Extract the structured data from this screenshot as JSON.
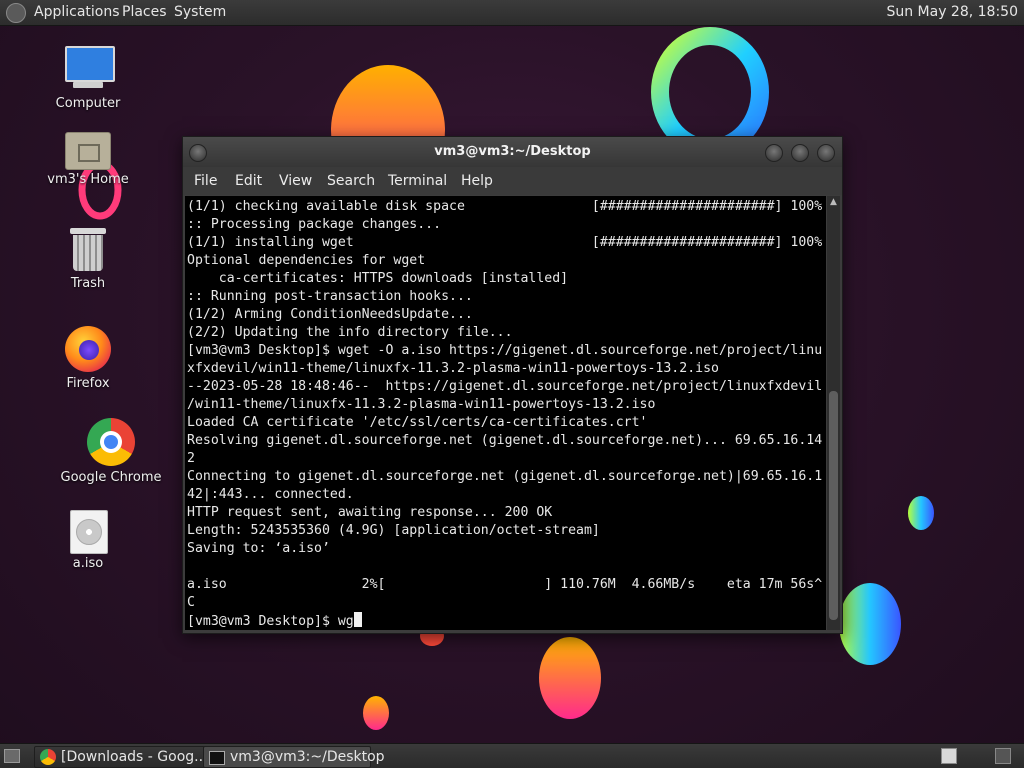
{
  "top_panel": {
    "menus": [
      "Applications",
      "Places",
      "System"
    ],
    "clock": "Sun May 28, 18:50"
  },
  "desktop_icons": [
    {
      "label": "Computer",
      "icon": "computer-icon"
    },
    {
      "label": "vm3's Home",
      "icon": "home-folder-icon"
    },
    {
      "label": "Trash",
      "icon": "trash-icon"
    },
    {
      "label": "Firefox",
      "icon": "firefox-icon"
    },
    {
      "label": "Google Chrome",
      "icon": "chrome-icon"
    },
    {
      "label": "a.iso",
      "icon": "disc-image-icon"
    }
  ],
  "terminal": {
    "title": "vm3@vm3:~/Desktop",
    "menu": [
      "File",
      "Edit",
      "View",
      "Search",
      "Terminal",
      "Help"
    ],
    "output": "(1/1) checking available disk space                [######################] 100%\n:: Processing package changes...\n(1/1) installing wget                              [######################] 100%\nOptional dependencies for wget\n    ca-certificates: HTTPS downloads [installed]\n:: Running post-transaction hooks...\n(1/2) Arming ConditionNeedsUpdate...\n(2/2) Updating the info directory file...\n[vm3@vm3 Desktop]$ wget -O a.iso https://gigenet.dl.sourceforge.net/project/linu\nxfxdevil/win11-theme/linuxfx-11.3.2-plasma-win11-powertoys-13.2.iso\n--2023-05-28 18:48:46--  https://gigenet.dl.sourceforge.net/project/linuxfxdevil\n/win11-theme/linuxfx-11.3.2-plasma-win11-powertoys-13.2.iso\nLoaded CA certificate '/etc/ssl/certs/ca-certificates.crt'\nResolving gigenet.dl.sourceforge.net (gigenet.dl.sourceforge.net)... 69.65.16.14\n2\nConnecting to gigenet.dl.sourceforge.net (gigenet.dl.sourceforge.net)|69.65.16.1\n42|:443... connected.\nHTTP request sent, awaiting response... 200 OK\nLength: 5243535360 (4.9G) [application/octet-stream]\nSaving to: ‘a.iso’\n\na.iso                 2%[                    ] 110.76M  4.66MB/s    eta 17m 56s^\nC\n[vm3@vm3 Desktop]$ wg"
  },
  "taskbar": {
    "tasks": [
      {
        "label": "[Downloads - Goog...",
        "icon": "chrome-icon"
      },
      {
        "label": "vm3@vm3:~/Desktop",
        "icon": "terminal-icon"
      }
    ]
  }
}
